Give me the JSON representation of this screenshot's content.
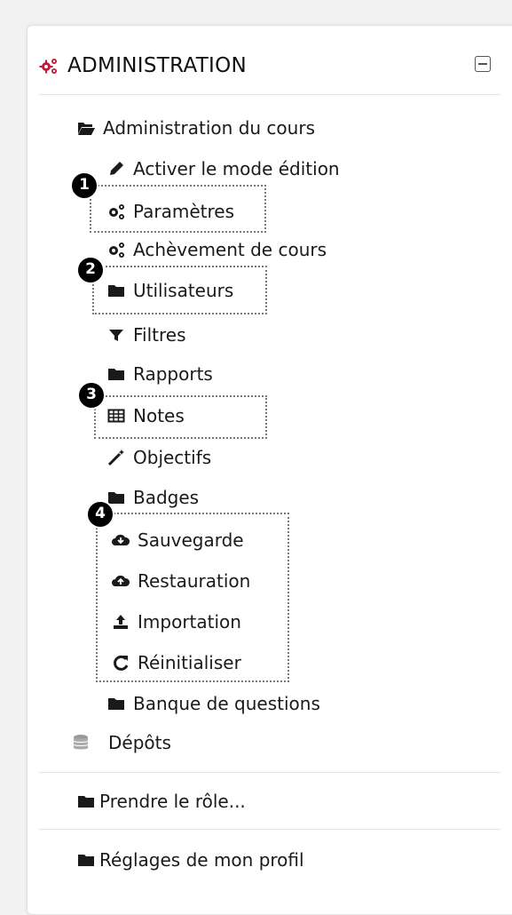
{
  "block": {
    "title": "ADMINISTRATION",
    "header_icon": "cogs-icon",
    "collapse_icon": "minus-square-icon"
  },
  "tree": {
    "course_admin": "Administration du cours",
    "items": [
      {
        "label": "Activer le mode édition",
        "icon": "pencil-icon"
      },
      {
        "label": "Paramètres",
        "icon": "cogs-icon"
      },
      {
        "label": "Achèvement de cours",
        "icon": "cogs-icon"
      },
      {
        "label": "Utilisateurs",
        "icon": "folder-icon"
      },
      {
        "label": "Filtres",
        "icon": "filter-icon"
      },
      {
        "label": "Rapports",
        "icon": "folder-icon"
      },
      {
        "label": "Notes",
        "icon": "table-icon"
      },
      {
        "label": "Objectifs",
        "icon": "magic-wand-icon"
      },
      {
        "label": "Badges",
        "icon": "folder-icon"
      },
      {
        "label": "Sauvegarde",
        "icon": "cloud-download-icon"
      },
      {
        "label": "Restauration",
        "icon": "cloud-upload-icon"
      },
      {
        "label": "Importation",
        "icon": "upload-icon"
      },
      {
        "label": "Réinitialiser",
        "icon": "refresh-icon"
      },
      {
        "label": "Banque de questions",
        "icon": "folder-icon"
      }
    ],
    "depots": "Dépôts"
  },
  "footer": {
    "switch_role": "Prendre le rôle...",
    "profile_settings": "Réglages de mon profil"
  },
  "callouts": [
    "1",
    "2",
    "3",
    "4"
  ]
}
